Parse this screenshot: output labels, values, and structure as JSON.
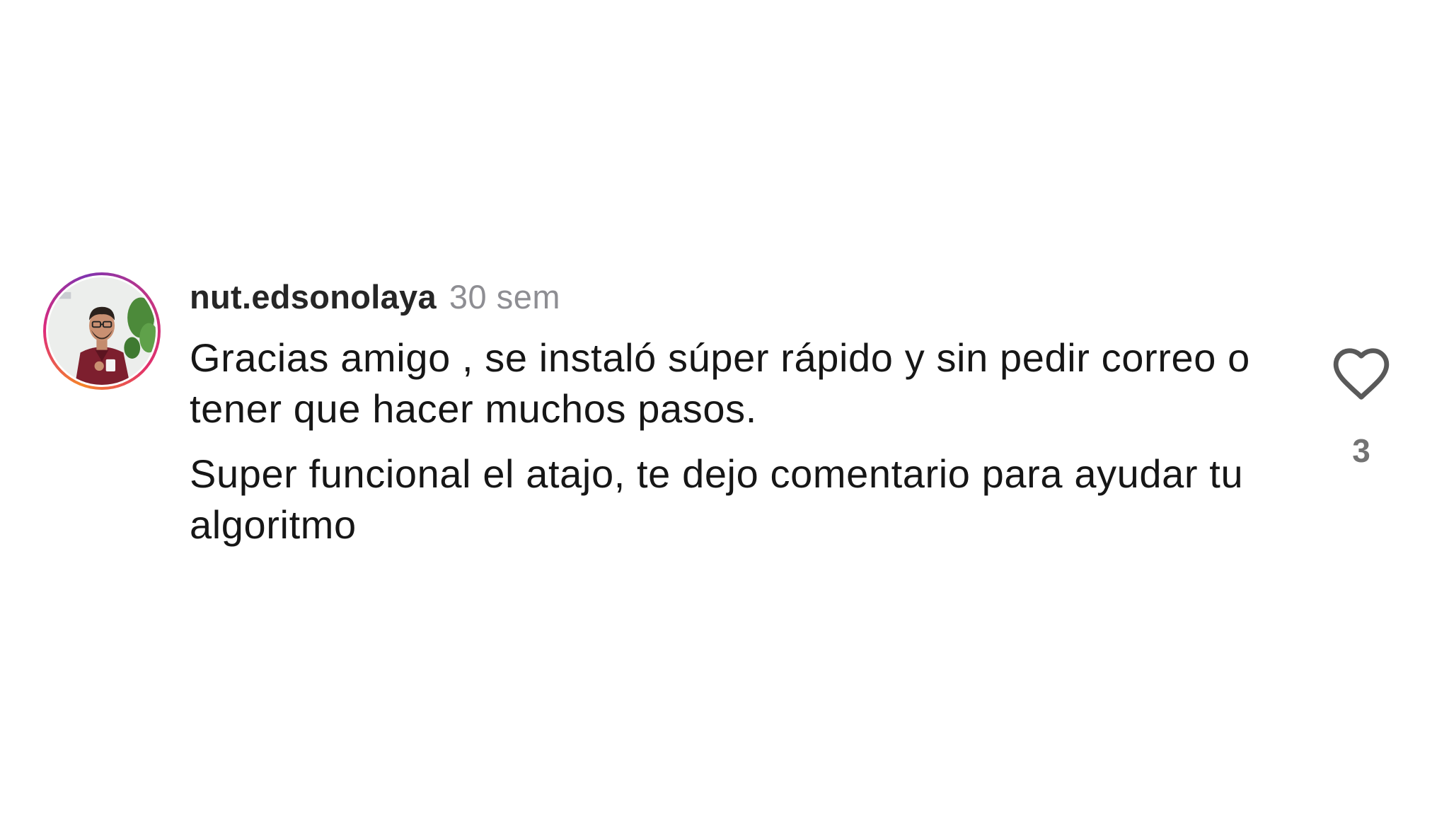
{
  "comment": {
    "username": "nut.edsonolaya",
    "timestamp": "30 sem",
    "paragraphs": [
      "Gracias amigo , se instaló súper rápido y sin pedir correo o tener que hacer muchos pasos.",
      "Super funcional el atajo, te dejo comentario para ayudar tu algoritmo"
    ],
    "like_count": "3",
    "like_icon": "heart-outline-icon",
    "avatar": "profile-photo"
  },
  "colors": {
    "text": "#161616",
    "username": "#262626",
    "muted": "#8e8e93",
    "icon": "#595959"
  }
}
